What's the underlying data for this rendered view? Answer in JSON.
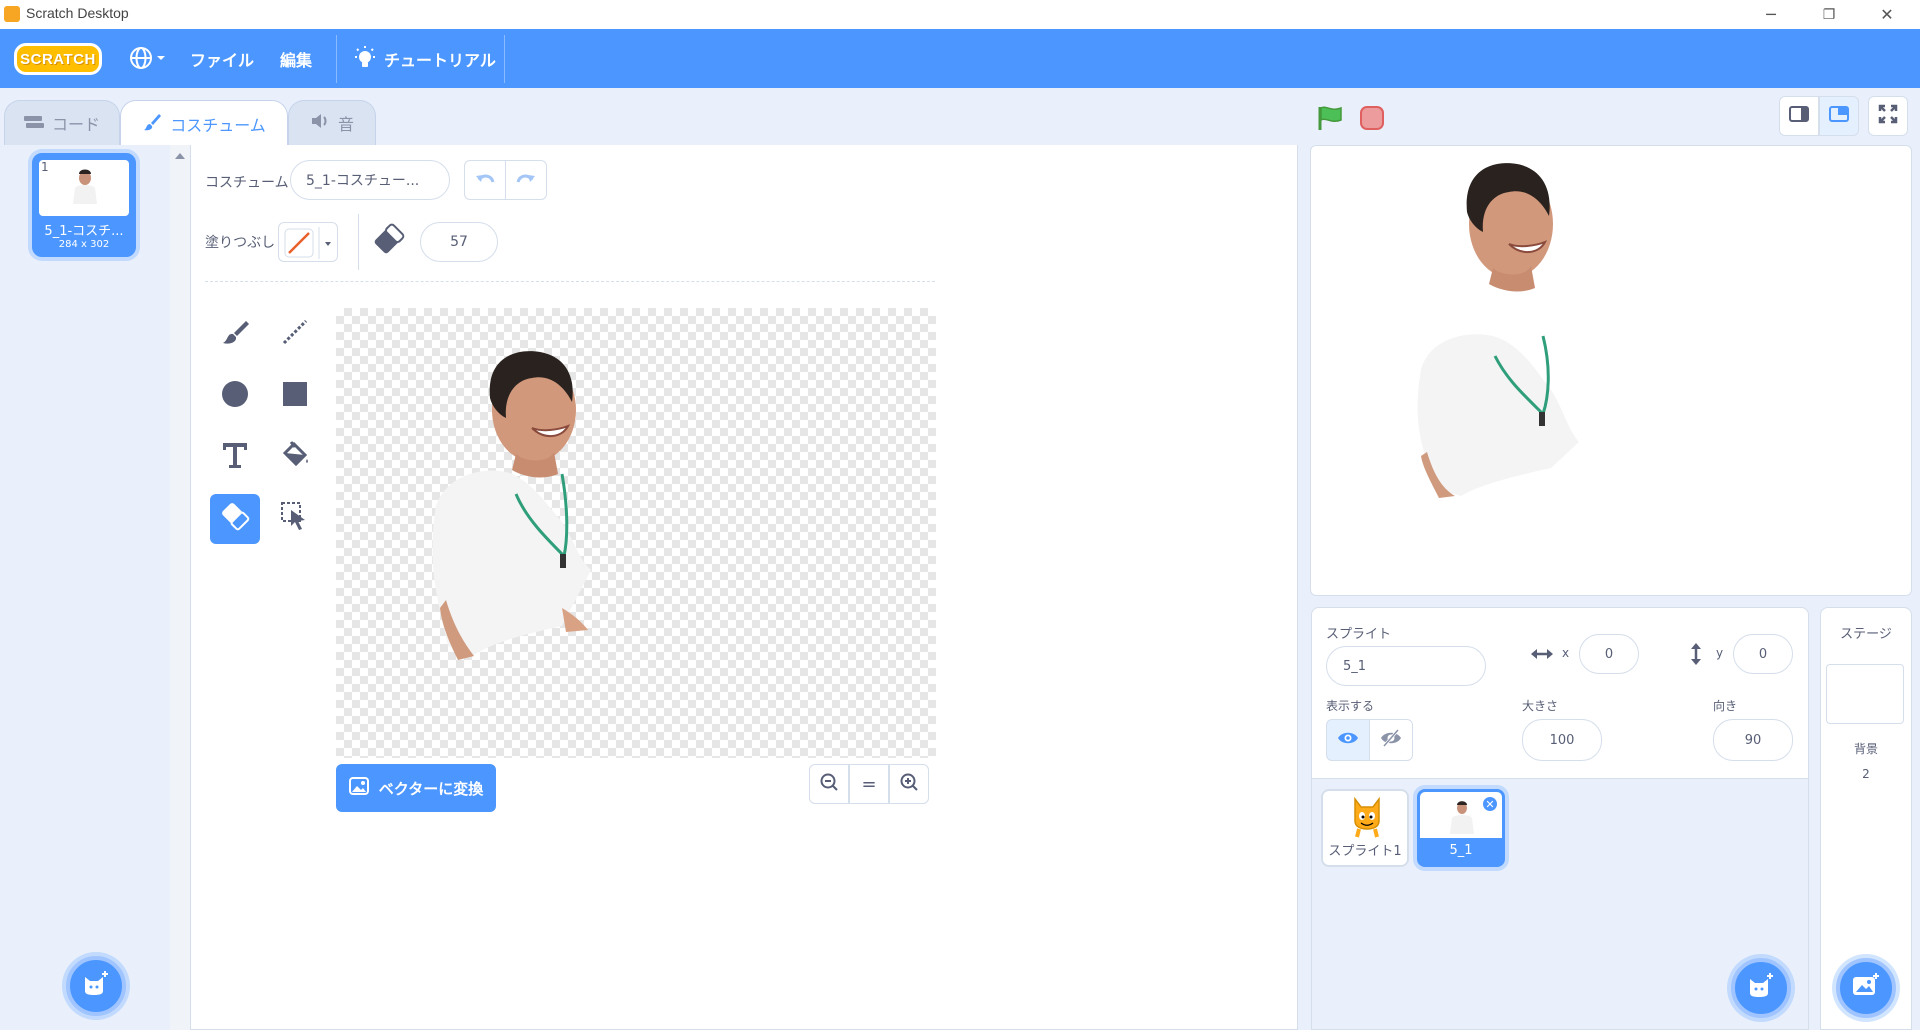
{
  "window": {
    "title": "Scratch Desktop",
    "controls": {
      "minimize": "─",
      "restore": "❐",
      "close": "✕"
    }
  },
  "menubar": {
    "logo": "SCRATCH",
    "language_icon": "globe-icon",
    "file": "ファイル",
    "edit": "編集",
    "tutorials": "チュートリアル"
  },
  "tabs": {
    "code": "コード",
    "costumes": "コスチューム",
    "sounds": "音"
  },
  "costume_list": {
    "items": [
      {
        "index": "1",
        "name": "5_1-コスチ...",
        "size": "284 x 302"
      }
    ]
  },
  "paint_editor": {
    "costume_label": "コスチューム",
    "costume_name": "5_1-コスチュー...",
    "fill_label": "塗りつぶし",
    "eraser_size": "57",
    "convert_button": "ベクターに変換",
    "zoom_reset": "="
  },
  "sprite_info": {
    "sprite_label": "スプライト",
    "sprite_name": "5_1",
    "x_label": "x",
    "x_value": "0",
    "y_label": "y",
    "y_value": "0",
    "show_label": "表示する",
    "size_label": "大きさ",
    "size_value": "100",
    "direction_label": "向き",
    "direction_value": "90"
  },
  "sprites": [
    {
      "name": "スプライト1"
    },
    {
      "name": "5_1"
    }
  ],
  "stage_panel": {
    "title": "ステージ",
    "backdrops_label": "背景",
    "backdrops_count": "2"
  },
  "colors": {
    "accent": "#4c97ff",
    "menubar": "#4c97ff",
    "background": "#e9f0fc",
    "flag": "#4cbf56",
    "stop": "#ec5959"
  }
}
